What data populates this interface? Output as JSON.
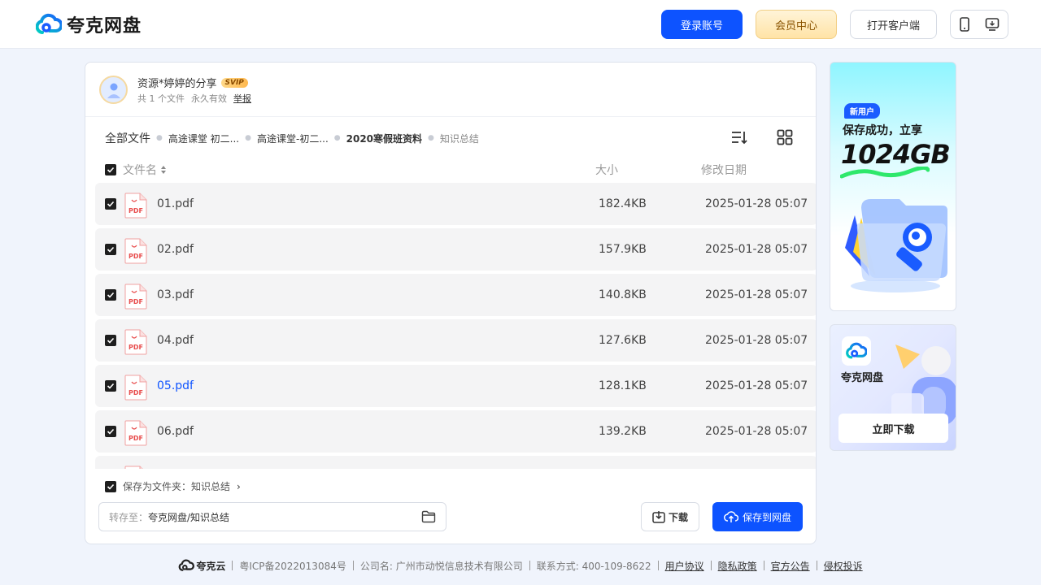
{
  "header": {
    "logo_text": "夸克网盘",
    "login_label": "登录账号",
    "vip_label": "会员中心",
    "client_label": "打开客户端"
  },
  "share": {
    "title": "资源*婷婷的分享",
    "badge": "SVIP",
    "file_count": "共 1 个文件",
    "validity": "永久有效",
    "report": "举报"
  },
  "breadcrumb": [
    "全部文件",
    "高途课堂 初二...",
    "高途课堂-初二...",
    "2020寒假班资料",
    "知识总结"
  ],
  "columns": {
    "name": "文件名",
    "size": "大小",
    "date": "修改日期"
  },
  "files": [
    {
      "name": "01.pdf",
      "size": "182.4KB",
      "date": "2025-01-28 05:07",
      "icon": "pdf-file-icon"
    },
    {
      "name": "02.pdf",
      "size": "157.9KB",
      "date": "2025-01-28 05:07",
      "icon": "pdf-file-icon"
    },
    {
      "name": "03.pdf",
      "size": "140.8KB",
      "date": "2025-01-28 05:07",
      "icon": "pdf-file-icon"
    },
    {
      "name": "04.pdf",
      "size": "127.6KB",
      "date": "2025-01-28 05:07",
      "icon": "pdf-file-icon"
    },
    {
      "name": "05.pdf",
      "size": "128.1KB",
      "date": "2025-01-28 05:07",
      "icon": "pdf-file-icon",
      "hovered": true
    },
    {
      "name": "06.pdf",
      "size": "139.2KB",
      "date": "2025-01-28 05:07",
      "icon": "pdf-file-icon"
    },
    {
      "name": "",
      "size": "",
      "date": "",
      "icon": "pdf-file-icon"
    }
  ],
  "footer_actions": {
    "save_as_folder": "保存为文件夹：知识总结",
    "dest_prefix": "转存至：",
    "dest_value": "夸克网盘/知识总结",
    "download": "下载",
    "save": "保存到网盘"
  },
  "ads": {
    "ad1_badge": "新用户",
    "ad1_line": "保存成功，立享",
    "ad1_big": "1024GB",
    "ad2_name": "夸克网盘",
    "ad2_button": "立即下载"
  },
  "footer": {
    "brand": "夸克云",
    "icp": "粤ICP备2022013084号",
    "company": "公司名: 广州市动悦信息技术有限公司",
    "contact": "联系方式: 400-109-8622",
    "links": [
      "用户协议",
      "隐私政策",
      "官方公告",
      "侵权投诉"
    ]
  },
  "colors": {
    "primary": "#0d53ff",
    "hover_text": "#0d53ff",
    "page_bg": "#f0f4fc"
  }
}
